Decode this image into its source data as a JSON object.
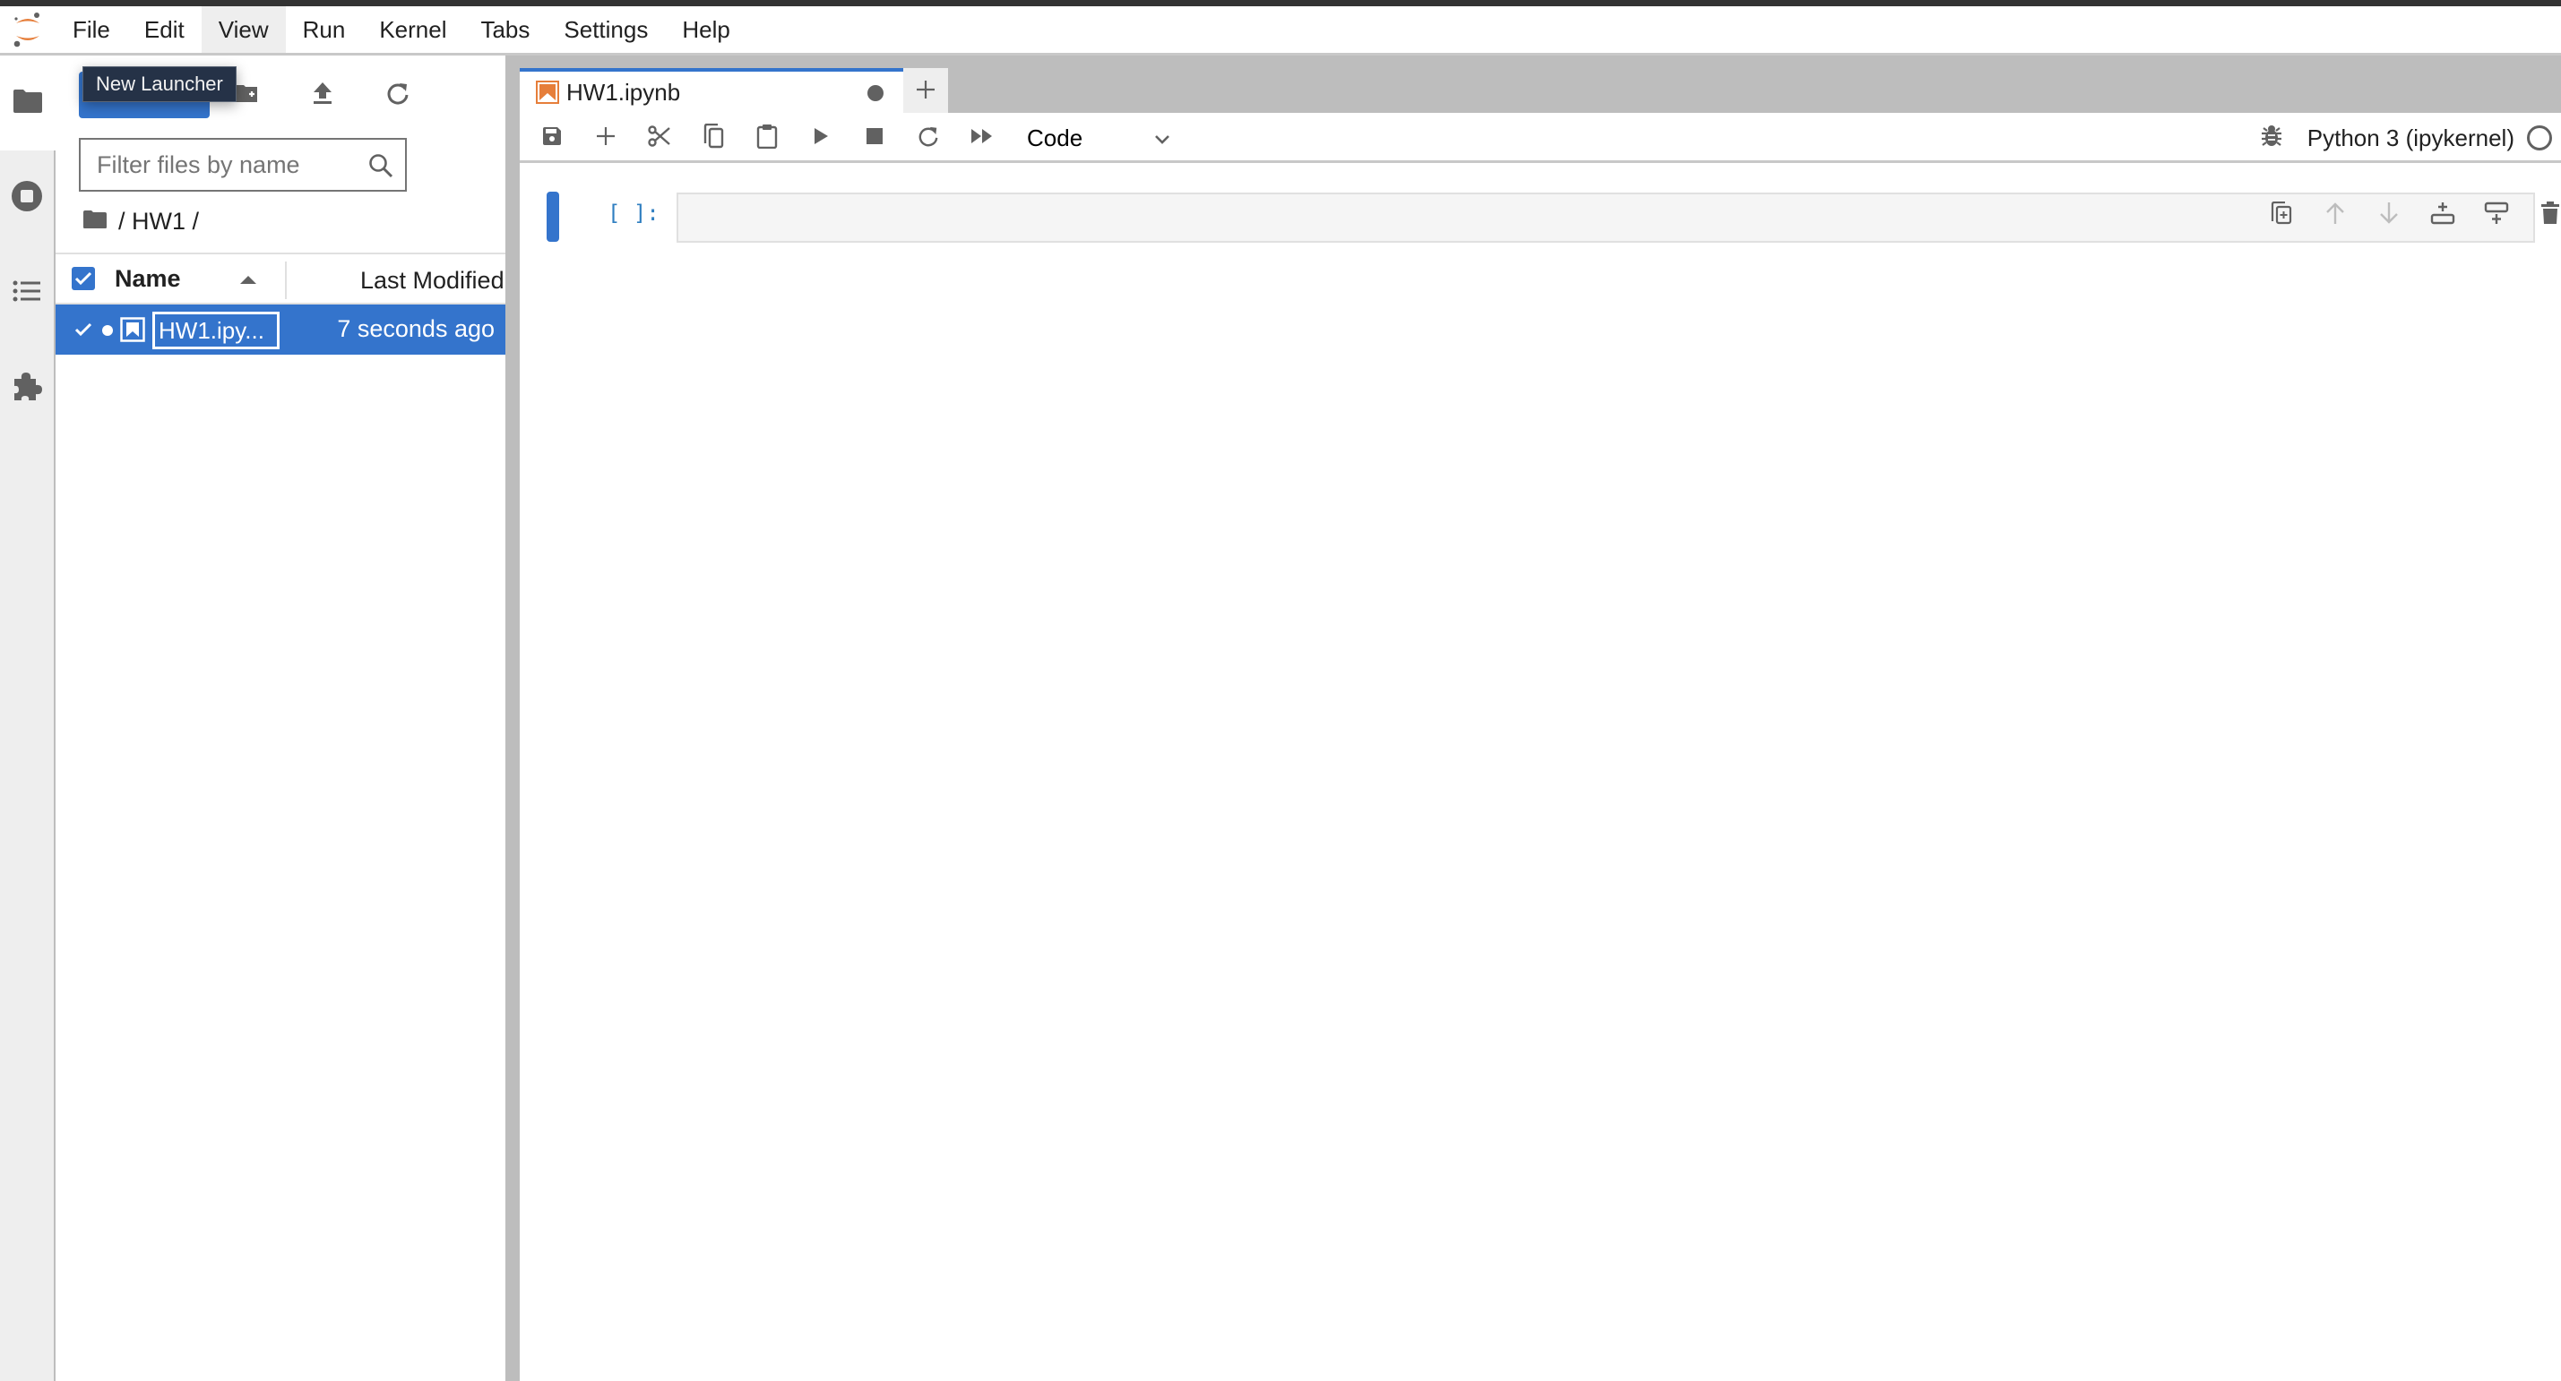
{
  "menubar": {
    "logo": "jupyter-logo",
    "items": [
      {
        "label": "File"
      },
      {
        "label": "Edit"
      },
      {
        "label": "View",
        "active": true
      },
      {
        "label": "Run"
      },
      {
        "label": "Kernel"
      },
      {
        "label": "Tabs"
      },
      {
        "label": "Settings"
      },
      {
        "label": "Help"
      }
    ]
  },
  "activity_bar": {
    "items": [
      {
        "icon": "folder-icon",
        "name": "file-browser",
        "active": true
      },
      {
        "icon": "running-icon",
        "name": "running-terminals-kernels"
      },
      {
        "icon": "table-of-contents-icon",
        "name": "table-of-contents"
      },
      {
        "icon": "extension-icon",
        "name": "extension-manager"
      }
    ]
  },
  "file_browser": {
    "toolbar": {
      "new_launcher_tooltip": "New Launcher",
      "buttons": [
        "new-launcher",
        "new-folder",
        "upload",
        "refresh"
      ]
    },
    "filter": {
      "placeholder": "Filter files by name",
      "value": ""
    },
    "breadcrumb": "/ HW1 /",
    "columns": {
      "name": "Name",
      "modified": "Last Modified",
      "sort": "ascending"
    },
    "files": [
      {
        "name": "HW1.ipy...",
        "full_name": "HW1.ipynb",
        "modified": "7 seconds ago",
        "selected": true,
        "running": true,
        "renaming": true
      }
    ]
  },
  "tabs": [
    {
      "title": "HW1.ipynb",
      "dirty": true,
      "active": true
    }
  ],
  "notebook_toolbar": {
    "buttons": [
      "save",
      "insert-cell",
      "cut",
      "copy",
      "paste",
      "run",
      "interrupt",
      "restart",
      "restart-run-all"
    ],
    "cell_type": "Code",
    "kernel_name": "Python 3 (ipykernel)",
    "kernel_status": "idle"
  },
  "cells": [
    {
      "type": "code",
      "prompt": "[ ]:",
      "source": ""
    }
  ],
  "colors": {
    "accent": "#3474cc",
    "jupyter_orange": "#e67e3a",
    "top_strip": "#333333",
    "panel_gray": "#eeeeee",
    "divider": "#bdbdbd",
    "tooltip_bg": "#253247"
  }
}
